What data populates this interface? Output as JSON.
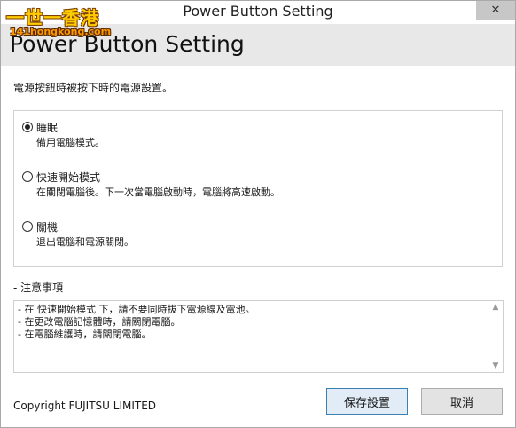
{
  "window": {
    "title": "Power Button Setting",
    "close_glyph": "✕"
  },
  "watermark": {
    "main": "一世一香港",
    "sub": "141hongkong.com"
  },
  "header": {
    "title": "Power Button Setting"
  },
  "prompt": "電源按鈕時被按下時的電源設置。",
  "options": [
    {
      "label": "睡眠",
      "description": "備用電腦模式。",
      "selected": true
    },
    {
      "label": "快速開始模式",
      "description": "在關閉電腦後。下一次當電腦啟動時，電腦將高速啟動。",
      "selected": false
    },
    {
      "label": "關機",
      "description": "退出電腦和電源關閉。",
      "selected": false
    }
  ],
  "notes": {
    "label": "- 注意事項",
    "lines": [
      "- 在 快速開始模式 下，請不要同時拔下電源線及電池。",
      "- 在更改電腦記憶體時，請關閉電腦。",
      "- 在電腦維護時，請關閉電腦。"
    ]
  },
  "footer": {
    "copyright": "Copyright FUJITSU LIMITED",
    "save_label": "保存設置",
    "cancel_label": "取消"
  }
}
